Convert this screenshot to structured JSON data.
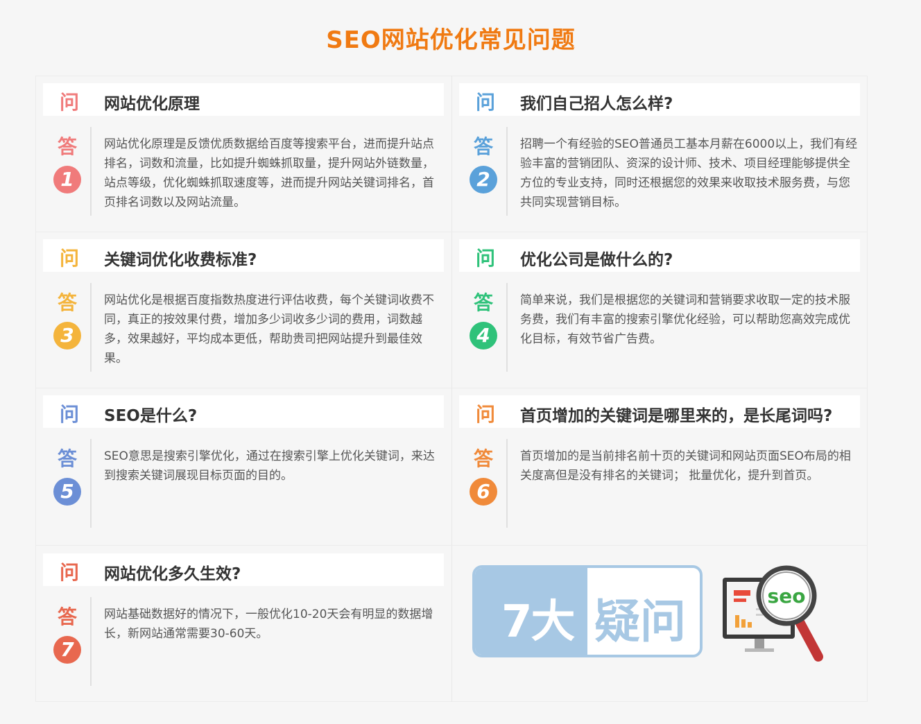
{
  "page_title": "SEO网站优化常见问题",
  "question_mark": "问",
  "answer_mark": "答",
  "faqs": [
    {
      "number": "1",
      "question": "网站优化原理",
      "answer": "网站优化原理是反馈优质数据给百度等搜索平台，进而提升站点排名，词数和流量，比如提升蜘蛛抓取量，提升网站外链数量，站点等级，优化蜘蛛抓取速度等，进而提升网站关键词排名，首页排名词数以及网站流量。",
      "color": "#f07b7b"
    },
    {
      "number": "2",
      "question": "我们自己招人怎么样?",
      "answer": "招聘一个有经验的SEO普通员工基本月薪在6000以上，我们有经验丰富的营销团队、资深的设计师、技术、项目经理能够提供全方位的专业支持，同时还根据您的效果来收取技术服务费，与您共同实现营销目标。",
      "color": "#5aa1da"
    },
    {
      "number": "3",
      "question": "关键词优化收费标准?",
      "answer": "网站优化是根据百度指数热度进行评估收费，每个关键词收费不同，真正的按效果付费，增加多少词收多少词的费用，词数越多，效果越好，平均成本更低，帮助贵司把网站提升到最佳效果。",
      "color": "#f4b43c"
    },
    {
      "number": "4",
      "question": "优化公司是做什么的?",
      "answer": "简单来说，我们是根据您的关键词和营销要求收取一定的技术服务费，我们有丰富的搜索引擎优化经验，可以帮助您高效完成优化目标，有效节省广告费。",
      "color": "#2fc27a"
    },
    {
      "number": "5",
      "question": "SEO是什么?",
      "answer": "SEO意思是搜索引擎优化，通过在搜索引擎上优化关键词，来达到搜索关键词展现目标页面的目的。",
      "color": "#6c8fd6"
    },
    {
      "number": "6",
      "question": "首页增加的关键词是哪里来的，是长尾词吗?",
      "answer": "首页增加的是当前排名前十页的关键词和网站页面SEO布局的相关度高但是没有排名的关键词； 批量优化，提升到首页。",
      "color": "#f08a3a"
    },
    {
      "number": "7",
      "question": "网站优化多久生效?",
      "answer": "网站基础数据好的情况下，一般优化10-20天会有明显的数据增长，新网站通常需要30-60天。",
      "color": "#e8684f"
    }
  ],
  "banner": {
    "left_text": "7大",
    "right_text": "疑问",
    "color": "#a7c8e4"
  },
  "illustration": {
    "icon": "seo-magnifier-monitor-icon",
    "seo_text": "seo"
  }
}
